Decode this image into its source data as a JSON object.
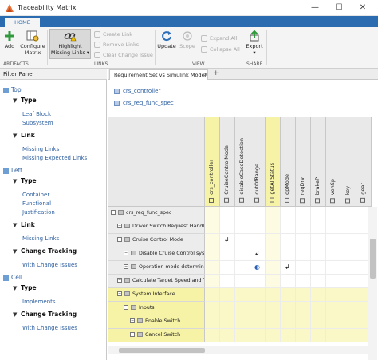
{
  "window": {
    "title": "Traceability Matrix",
    "minimize": "—",
    "maximize": "☐",
    "close": "✕"
  },
  "ribbon": {
    "tab": "HOME",
    "buttons": {
      "add": "Add",
      "configure_line1": "Configure",
      "configure_line2": "Matrix",
      "highlight_line1": "Highlight",
      "highlight_line2": "Missing Links ▾",
      "create_link": "Create Link",
      "remove_links": "Remove Links",
      "clear_change_issue": "Clear Change Issue",
      "update": "Update",
      "scope": "Scope",
      "expand_all": "Expand All",
      "collapse_all": "Collapse All",
      "export": "Export",
      "export_arrow": "▾"
    },
    "groups": {
      "artifacts": "ARTIFACTS",
      "links": "LINKS",
      "view": "VIEW",
      "share": "SHARE"
    }
  },
  "filter_panel": {
    "title": "Filter Panel",
    "items": [
      {
        "level": 1,
        "label": "Top"
      },
      {
        "level": 2,
        "label": "Type"
      },
      {
        "level": 3,
        "label": "Leaf Block"
      },
      {
        "level": 3,
        "label": "Subsystem"
      },
      {
        "level": 2,
        "label": "Link"
      },
      {
        "level": 3,
        "label": "Missing Links"
      },
      {
        "level": 3,
        "label": "Missing Expected Links"
      },
      {
        "level": 1,
        "label": "Left"
      },
      {
        "level": 2,
        "label": "Type"
      },
      {
        "level": 3,
        "label": "Container"
      },
      {
        "level": 3,
        "label": "Functional"
      },
      {
        "level": 3,
        "label": "Justification"
      },
      {
        "level": 2,
        "label": "Link"
      },
      {
        "level": 3,
        "label": "Missing Links"
      },
      {
        "level": 2,
        "label": "Change Tracking"
      },
      {
        "level": 3,
        "label": "With Change Issues"
      },
      {
        "level": 1,
        "label": "Cell"
      },
      {
        "level": 2,
        "label": "Type"
      },
      {
        "level": 3,
        "label": "Implements"
      },
      {
        "level": 2,
        "label": "Change Tracking"
      },
      {
        "level": 3,
        "label": "With Change Issues"
      }
    ]
  },
  "document_tab": {
    "label": "Requirement Set vs Simulink Model",
    "close": "✕",
    "add": "+"
  },
  "artifacts": [
    "crs_controller",
    "crs_req_func_spec"
  ],
  "matrix": {
    "columns": [
      "crs_controller",
      "CruiseControlMode",
      "disableCaseDetection",
      "outOfRange",
      "getAllStatus",
      "opMode",
      "reqDrv",
      "brakeP",
      "vehSp",
      "key",
      "gear"
    ],
    "highlight_columns": [
      0,
      4
    ],
    "rows": [
      {
        "label": "crs_req_func_spec",
        "indent": 0,
        "highlight": false
      },
      {
        "label": "Driver Switch Request Handling",
        "indent": 1,
        "highlight": false
      },
      {
        "label": "Cruise Control Mode",
        "indent": 1,
        "highlight": false
      },
      {
        "label": "Disable Cruise Control system",
        "indent": 2,
        "highlight": false
      },
      {
        "label": "Operation mode determination",
        "indent": 2,
        "highlight": false
      },
      {
        "label": "Calculate Target Speed and Throttle",
        "indent": 1,
        "highlight": false
      },
      {
        "label": "System Interface",
        "indent": 1,
        "highlight": true
      },
      {
        "label": "Inputs",
        "indent": 2,
        "highlight": true
      },
      {
        "label": "Enable Switch",
        "indent": 3,
        "highlight": true
      },
      {
        "label": "Cancel Switch",
        "indent": 3,
        "highlight": true
      }
    ],
    "marks": [
      {
        "row": 2,
        "col": 1,
        "symbol": "↲"
      },
      {
        "row": 3,
        "col": 3,
        "symbol": "↲"
      },
      {
        "row": 4,
        "col": 3,
        "symbol": "◐"
      },
      {
        "row": 4,
        "col": 5,
        "symbol": "↲"
      }
    ]
  }
}
